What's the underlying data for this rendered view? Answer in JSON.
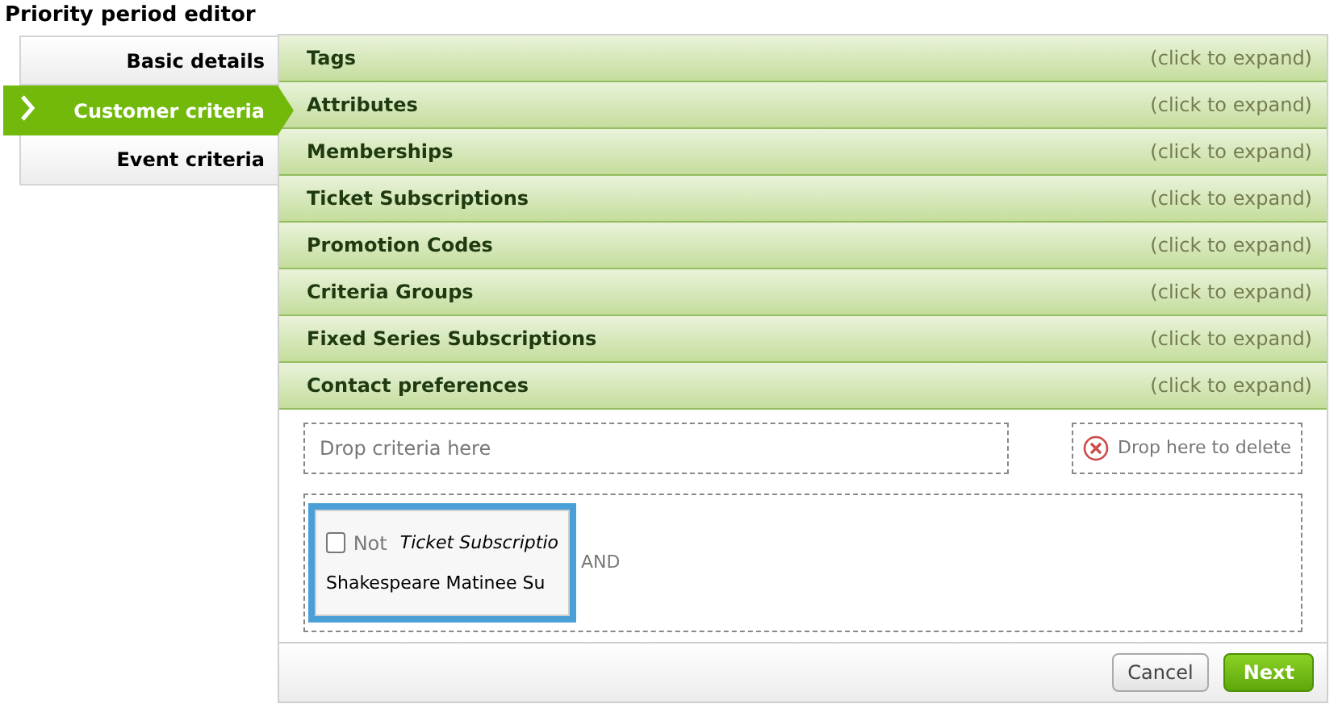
{
  "title": "Priority period editor",
  "sidebar": {
    "items": [
      {
        "label": "Basic details",
        "selected": false
      },
      {
        "label": "Customer criteria",
        "selected": true
      },
      {
        "label": "Event criteria",
        "selected": false
      }
    ]
  },
  "sections": [
    {
      "label": "Tags",
      "hint": "(click to expand)"
    },
    {
      "label": "Attributes",
      "hint": "(click to expand)"
    },
    {
      "label": "Memberships",
      "hint": "(click to expand)"
    },
    {
      "label": "Ticket Subscriptions",
      "hint": "(click to expand)"
    },
    {
      "label": "Promotion Codes",
      "hint": "(click to expand)"
    },
    {
      "label": "Criteria Groups",
      "hint": "(click to expand)"
    },
    {
      "label": "Fixed Series Subscriptions",
      "hint": "(click to expand)"
    },
    {
      "label": "Contact preferences",
      "hint": "(click to expand)"
    }
  ],
  "drop_zone": "Drop criteria here",
  "delete_zone": "Drop here to delete",
  "criteria": [
    {
      "not_label": "Not",
      "checked": false,
      "type": "Ticket Subscriptio",
      "value": "Shakespeare Matinee Su",
      "selected": true,
      "operator": "AND"
    }
  ],
  "buttons": {
    "cancel": "Cancel",
    "next": "Next"
  }
}
